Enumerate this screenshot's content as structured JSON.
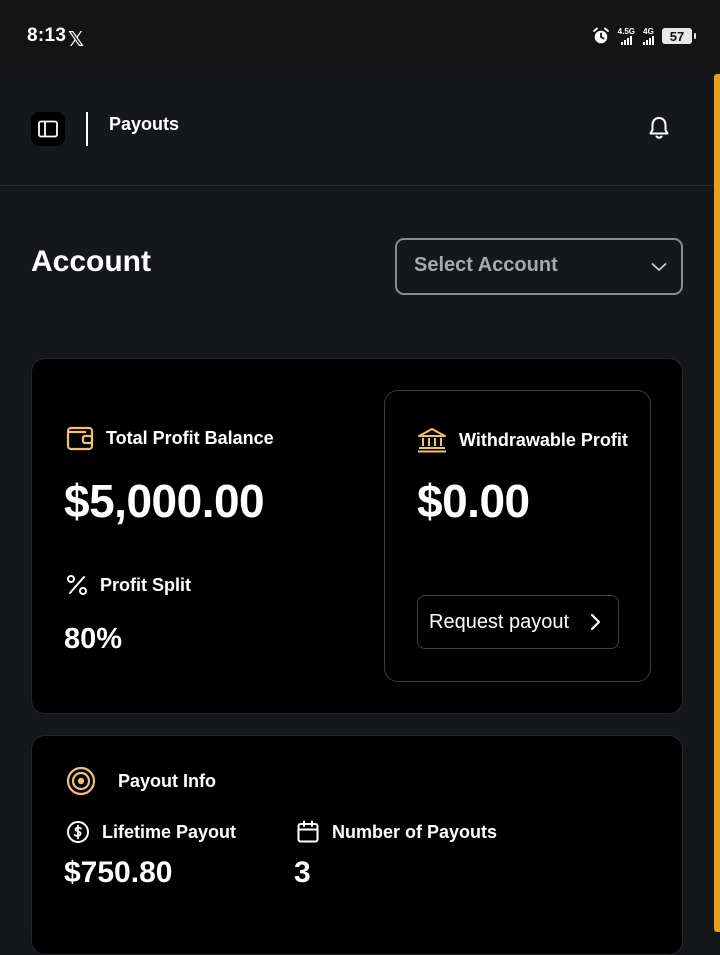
{
  "status_bar": {
    "time": "8:13",
    "x_logo": "𝕏",
    "net1": "4.5G",
    "net2": "4G",
    "battery": "57"
  },
  "header": {
    "title": "Payouts"
  },
  "account": {
    "label": "Account",
    "select_placeholder": "Select Account"
  },
  "balance_card": {
    "total_profit_label": "Total Profit Balance",
    "total_profit_value": "$5,000.00",
    "profit_split_label": "Profit Split",
    "profit_split_value": "80%",
    "withdrawable_label": "Withdrawable Profit",
    "withdrawable_value": "$0.00",
    "request_button": "Request payout"
  },
  "payout_info": {
    "title": "Payout Info",
    "lifetime_label": "Lifetime Payout",
    "lifetime_value": "$750.80",
    "count_label": "Number of Payouts",
    "count_value": "3"
  },
  "colors": {
    "accent": "#f0c078",
    "scrollbar": "#e8a21a",
    "background": "#16171b",
    "card": "#000000"
  }
}
